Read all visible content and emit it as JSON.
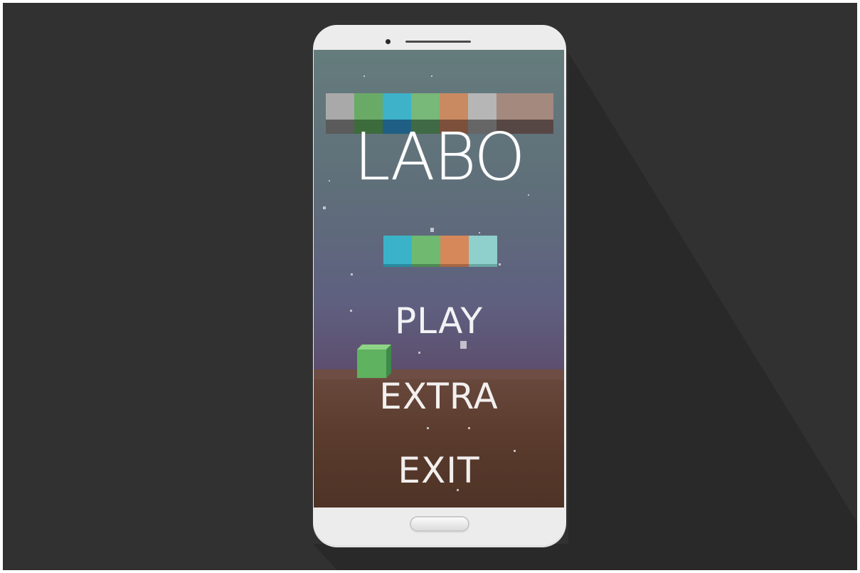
{
  "game": {
    "title": "LABO",
    "menu": {
      "play": "PLAY",
      "extra": "EXTRA",
      "exit": "EXIT"
    }
  },
  "colors": {
    "background": "#313131",
    "phone_body": "#ececec",
    "floor": "#5b3c2e",
    "block_gray": "#a9a9a9",
    "block_green": "#6fae6a",
    "block_cyan": "#3ab3c9",
    "block_orange": "#d4875a",
    "block_tan": "#a28a7e",
    "block_mint": "#8ccfcb"
  },
  "icons": {
    "camera": "camera-icon",
    "speaker": "speaker-icon",
    "home": "home-button-icon"
  }
}
